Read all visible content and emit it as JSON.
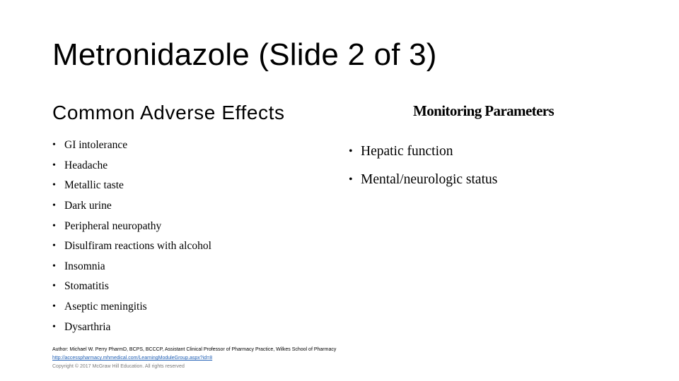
{
  "slide": {
    "title": "Metronidazole (Slide 2 of 3)"
  },
  "left_column": {
    "heading": "Common Adverse Effects",
    "bullet_glyph": "•",
    "items": [
      "GI intolerance",
      "Headache",
      "Metallic taste",
      "Dark urine",
      "Peripheral neuropathy",
      "Disulfiram reactions with alcohol",
      "Insomnia",
      "Stomatitis",
      "Aseptic meningitis",
      "Dysarthria"
    ]
  },
  "right_column": {
    "heading": "Monitoring Parameters",
    "bullet_glyph": "•",
    "items": [
      "Hepatic function",
      "Mental/neurologic status"
    ]
  },
  "footer": {
    "author": "Author: Michael W. Perry PharmD, BCPS, BCCCP, Assistant Clinical Professor of Pharmacy Practice, Wilkes School of Pharmacy",
    "link": "http://accesspharmacy.mhmedical.com/LearningModuleGroup.aspx?id=8",
    "copyright": "Copyright © 2017 McGraw Hill Education. All rights reserved"
  },
  "colors": {
    "background": "#ffffff",
    "text": "#000000",
    "link": "#1f5fb5",
    "copyright": "#7a7a7a"
  }
}
